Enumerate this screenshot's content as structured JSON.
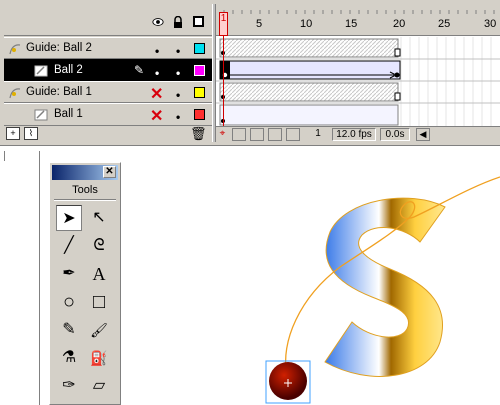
{
  "timeline": {
    "header_icons": [
      "eye-icon",
      "lock-icon",
      "outline-icon"
    ],
    "layers": [
      {
        "name": "Guide: Ball 2",
        "type": "motion-guide",
        "visible": "•",
        "locked": "•",
        "color": "#00e0f0",
        "selected": false,
        "hidden_x": false
      },
      {
        "name": "Ball 2",
        "type": "guided",
        "visible": "•",
        "locked": "•",
        "color": "#ff00ff",
        "selected": true,
        "hidden_x": false
      },
      {
        "name": "Guide: Ball 1",
        "type": "motion-guide",
        "visible": "✕",
        "locked": "•",
        "color": "#ffff00",
        "selected": false,
        "hidden_x": true
      },
      {
        "name": "Ball 1",
        "type": "guided",
        "visible": "✕",
        "locked": "•",
        "color": "#ff3030",
        "selected": false,
        "hidden_x": true
      }
    ],
    "ruler_ticks": [
      "1",
      "5",
      "10",
      "15",
      "20",
      "25",
      "30"
    ],
    "current_frame": "1",
    "frame_rate": "12.0 fps",
    "elapsed_time": "0.0s"
  },
  "tools_panel": {
    "title": "Tools",
    "close_label": "✕",
    "tools": [
      {
        "name": "arrow-tool",
        "glyph": "➤",
        "active": true
      },
      {
        "name": "subselect-tool",
        "glyph": "↖",
        "active": false
      },
      {
        "name": "line-tool",
        "glyph": "╱",
        "active": false
      },
      {
        "name": "lasso-tool",
        "glyph": "ᘓ",
        "active": false
      },
      {
        "name": "pen-tool",
        "glyph": "✒",
        "active": false
      },
      {
        "name": "text-tool",
        "glyph": "A",
        "active": false
      },
      {
        "name": "oval-tool",
        "glyph": "○",
        "active": false
      },
      {
        "name": "rectangle-tool",
        "glyph": "□",
        "active": false
      },
      {
        "name": "pencil-tool",
        "glyph": "✎",
        "active": false
      },
      {
        "name": "brush-tool",
        "glyph": "🖌",
        "active": false
      },
      {
        "name": "ink-bottle-tool",
        "glyph": "⚗",
        "active": false
      },
      {
        "name": "paint-bucket-tool",
        "glyph": "⛽",
        "active": false
      },
      {
        "name": "dropper-tool",
        "glyph": "✑",
        "active": false
      },
      {
        "name": "eraser-tool",
        "glyph": "▱",
        "active": false
      }
    ]
  },
  "colors": {
    "selected_row": "#000000",
    "panel_bg": "#d4d0c8",
    "playhead": "#d00000",
    "guide_path": "#f0a020",
    "ball_fill": "#8a0000",
    "selection_box": "#40a0ff"
  }
}
